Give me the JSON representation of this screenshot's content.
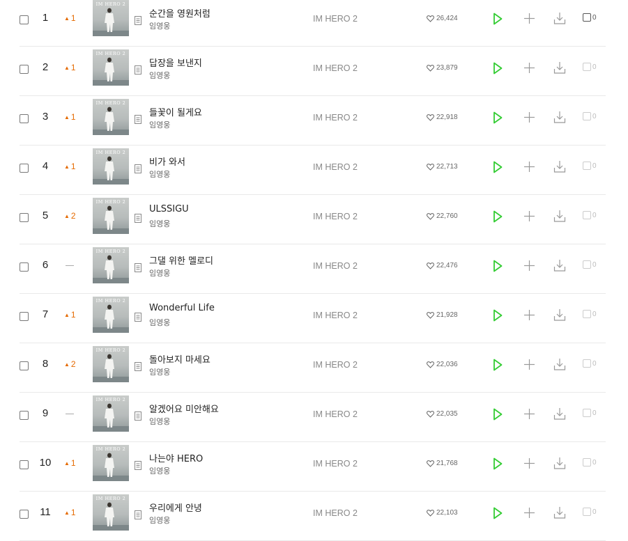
{
  "colors": {
    "play": "#33cc33",
    "rank_up": "#e56a00",
    "divider": "#e9e9e9"
  },
  "icons": {
    "info": "document-icon",
    "like": "heart-icon",
    "play": "play-icon",
    "add": "plus-icon",
    "download": "download-icon",
    "video": "video-icon"
  },
  "songs": [
    {
      "rank": "1",
      "change": "1",
      "direction": "up",
      "title": "순간을 영원처럼",
      "artist": "임영웅",
      "album": "IM HERO 2",
      "likes": "26,424",
      "video": "0"
    },
    {
      "rank": "2",
      "change": "1",
      "direction": "up",
      "title": "답장을 보낸지",
      "artist": "임영웅",
      "album": "IM HERO 2",
      "likes": "23,879",
      "video": "0"
    },
    {
      "rank": "3",
      "change": "1",
      "direction": "up",
      "title": "들꽃이 될게요",
      "artist": "임영웅",
      "album": "IM HERO 2",
      "likes": "22,918",
      "video": "0"
    },
    {
      "rank": "4",
      "change": "1",
      "direction": "up",
      "title": "비가 와서",
      "artist": "임영웅",
      "album": "IM HERO 2",
      "likes": "22,713",
      "video": "0"
    },
    {
      "rank": "5",
      "change": "2",
      "direction": "up",
      "title": "ULSSIGU",
      "artist": "임영웅",
      "album": "IM HERO 2",
      "likes": "22,760",
      "video": "0"
    },
    {
      "rank": "6",
      "change": "",
      "direction": "none",
      "title": "그댈 위한 멜로디",
      "artist": "임영웅",
      "album": "IM HERO 2",
      "likes": "22,476",
      "video": "0"
    },
    {
      "rank": "7",
      "change": "1",
      "direction": "up",
      "title": "Wonderful Life",
      "artist": "임영웅",
      "album": "IM HERO 2",
      "likes": "21,928",
      "video": "0"
    },
    {
      "rank": "8",
      "change": "2",
      "direction": "up",
      "title": "돌아보지 마세요",
      "artist": "임영웅",
      "album": "IM HERO 2",
      "likes": "22,036",
      "video": "0"
    },
    {
      "rank": "9",
      "change": "",
      "direction": "none",
      "title": "알겠어요 미안해요",
      "artist": "임영웅",
      "album": "IM HERO 2",
      "likes": "22,035",
      "video": "0"
    },
    {
      "rank": "10",
      "change": "1",
      "direction": "up",
      "title": "나는야 HERO",
      "artist": "임영웅",
      "album": "IM HERO 2",
      "likes": "21,768",
      "video": "0"
    },
    {
      "rank": "11",
      "change": "1",
      "direction": "up",
      "title": "우리에게 안녕",
      "artist": "임영웅",
      "album": "IM HERO 2",
      "likes": "22,103",
      "video": "0"
    }
  ]
}
